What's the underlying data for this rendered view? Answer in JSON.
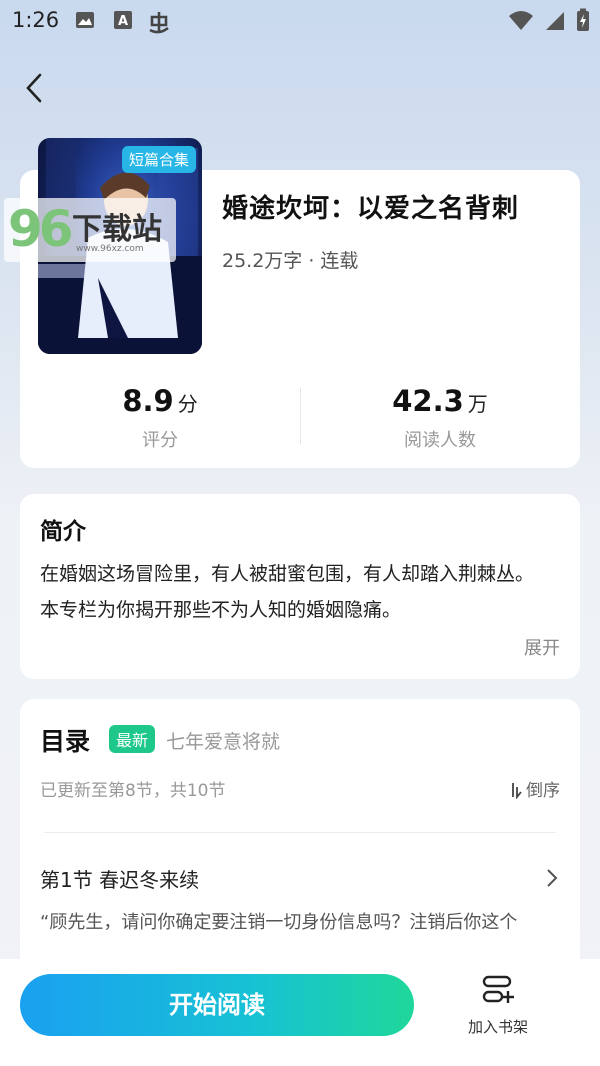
{
  "status_bar": {
    "time": "1:26",
    "left_icons": [
      "image-icon",
      "font-a-icon",
      "bug-app-icon"
    ],
    "right_icons": [
      "wifi-icon",
      "signal-icon",
      "battery-charging-icon"
    ]
  },
  "book": {
    "cover_tag": "短篇合集",
    "title": "婚途坎坷：以爱之名背刺",
    "meta": "25.2万字 · 连载",
    "rating": {
      "value": "8.9",
      "unit": "分",
      "label": "评分"
    },
    "readers": {
      "value": "42.3",
      "unit": "万",
      "label": "阅读人数"
    }
  },
  "watermark": {
    "number": "96",
    "text": "下载站",
    "url": "www.96xz.com"
  },
  "intro": {
    "heading": "简介",
    "body": "在婚姻这场冒险里，有人被甜蜜包围，有人却踏入荆棘丛。\n本专栏为你揭开那些不为人知的婚姻隐痛。",
    "expand_label": "展开"
  },
  "toc": {
    "heading": "目录",
    "new_badge": "最新",
    "latest_chapter": "七年爱意将就",
    "update_info": "已更新至第8节，共10节",
    "sort_label": "倒序",
    "chapters": [
      {
        "title": "第1节 春迟冬来续",
        "excerpt": "“顾先生，请问你确定要注销一切身份信息吗？注销后你这个"
      }
    ]
  },
  "bottom": {
    "start_label": "开始阅读",
    "shelf_label": "加入书架"
  },
  "colors": {
    "accent_gradient_start": "#1aa0f0",
    "accent_gradient_end": "#1fd79a",
    "new_badge": "#1ec88b",
    "cover_tag": "#27b6e6"
  }
}
